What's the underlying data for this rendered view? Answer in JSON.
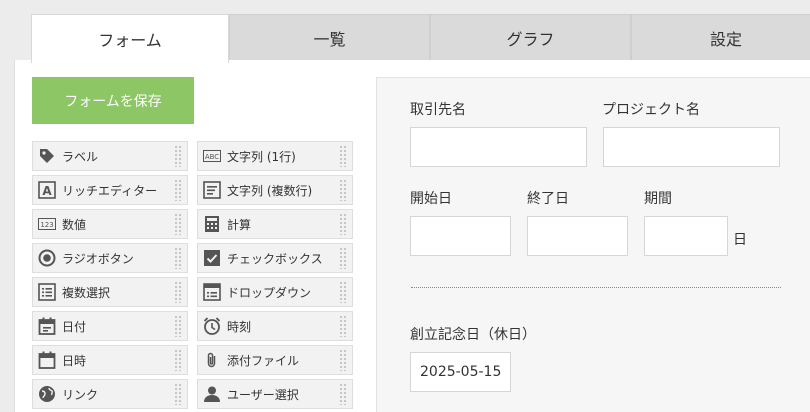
{
  "tabs": [
    {
      "label": "フォーム",
      "active": true
    },
    {
      "label": "一覧",
      "active": false
    },
    {
      "label": "グラフ",
      "active": false
    },
    {
      "label": "設定",
      "active": false
    }
  ],
  "save_button": "フォームを保存",
  "palette": [
    {
      "label": "ラベル",
      "icon": "tag-icon"
    },
    {
      "label": "文字列 (1行)",
      "icon": "abc-text-icon"
    },
    {
      "label": "リッチエディター",
      "icon": "rich-editor-icon"
    },
    {
      "label": "文字列 (複数行)",
      "icon": "multiline-text-icon"
    },
    {
      "label": "数値",
      "icon": "number-icon"
    },
    {
      "label": "計算",
      "icon": "calculator-icon"
    },
    {
      "label": "ラジオボタン",
      "icon": "radio-icon"
    },
    {
      "label": "チェックボックス",
      "icon": "checkbox-icon"
    },
    {
      "label": "複数選択",
      "icon": "multi-select-icon"
    },
    {
      "label": "ドロップダウン",
      "icon": "dropdown-icon"
    },
    {
      "label": "日付",
      "icon": "calendar-icon"
    },
    {
      "label": "時刻",
      "icon": "clock-icon"
    },
    {
      "label": "日時",
      "icon": "datetime-icon"
    },
    {
      "label": "添付ファイル",
      "icon": "paperclip-icon"
    },
    {
      "label": "リンク",
      "icon": "globe-icon"
    },
    {
      "label": "ユーザー選択",
      "icon": "user-icon"
    }
  ],
  "form": {
    "client_label": "取引先名",
    "client_value": "",
    "project_label": "プロジェクト名",
    "project_value": "",
    "start_label": "開始日",
    "start_value": "",
    "end_label": "終了日",
    "end_value": "",
    "period_label": "期間",
    "period_value": "",
    "period_unit": "日",
    "anniversary_label": "創立記念日（休日）",
    "anniversary_value": "2025-05-15"
  },
  "colors": {
    "save_button": "#8dc665",
    "tab_active": "#ffffff",
    "tab_inactive": "#dadada"
  }
}
